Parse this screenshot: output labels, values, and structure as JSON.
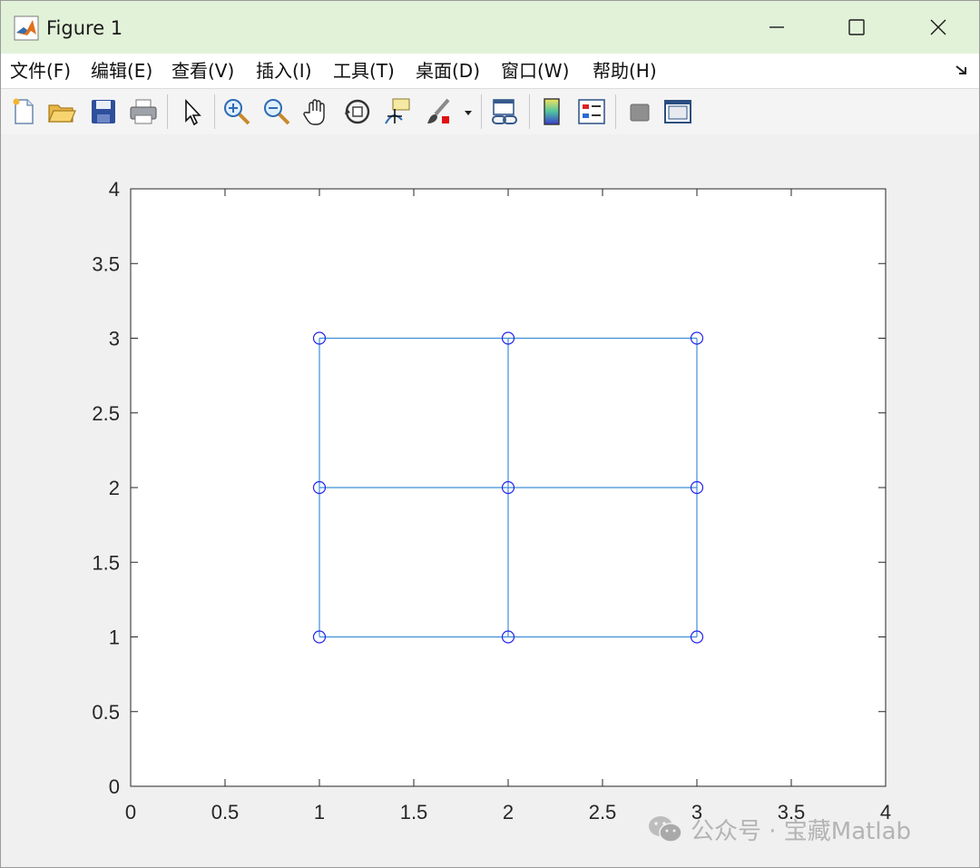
{
  "window": {
    "title": "Figure 1"
  },
  "menu": [
    {
      "label": "文件(F)",
      "name": "menu-file"
    },
    {
      "label": "编辑(E)",
      "name": "menu-edit"
    },
    {
      "label": "查看(V)",
      "name": "menu-view"
    },
    {
      "label": "插入(I)",
      "name": "menu-insert"
    },
    {
      "label": "工具(T)",
      "name": "menu-tools"
    },
    {
      "label": "桌面(D)",
      "name": "menu-desktop"
    },
    {
      "label": "窗口(W)",
      "name": "menu-window"
    },
    {
      "label": "帮助(H)",
      "name": "menu-help"
    }
  ],
  "toolbar": [
    {
      "icon": "new-figure-icon"
    },
    {
      "icon": "open-file-icon"
    },
    {
      "icon": "save-icon"
    },
    {
      "icon": "print-icon"
    },
    {
      "icon": "select-pointer-icon"
    },
    {
      "icon": "zoom-in-icon"
    },
    {
      "icon": "zoom-out-icon"
    },
    {
      "icon": "pan-hand-icon"
    },
    {
      "icon": "rotate-3d-icon"
    },
    {
      "icon": "data-cursor-icon"
    },
    {
      "icon": "brush-icon"
    },
    {
      "icon": "link-plot-icon"
    },
    {
      "icon": "colorbar-icon"
    },
    {
      "icon": "legend-icon"
    },
    {
      "icon": "hide-plot-tools-icon"
    },
    {
      "icon": "show-plot-tools-icon"
    }
  ],
  "colors": {
    "line": "#3f8fd6",
    "marker": "#2323ee",
    "axes_bg": "#ffffff",
    "axis_line": "#262626",
    "title_bar_bg": "#e2f2d9"
  },
  "chart_data": {
    "type": "line",
    "xlim": [
      0,
      4
    ],
    "ylim": [
      0,
      4
    ],
    "xticks": [
      "0",
      "0.5",
      "1",
      "1.5",
      "2",
      "2.5",
      "3",
      "3.5",
      "4"
    ],
    "yticks": [
      "0",
      "0.5",
      "1",
      "1.5",
      "2",
      "2.5",
      "3",
      "3.5",
      "4"
    ],
    "grid": false,
    "series": [
      {
        "x": [
          1,
          1,
          1
        ],
        "y": [
          1,
          2,
          3
        ]
      },
      {
        "x": [
          2,
          2,
          2
        ],
        "y": [
          1,
          2,
          3
        ]
      },
      {
        "x": [
          3,
          3,
          3
        ],
        "y": [
          1,
          2,
          3
        ]
      },
      {
        "x": [
          1,
          2,
          3
        ],
        "y": [
          1,
          1,
          1
        ]
      },
      {
        "x": [
          1,
          2,
          3
        ],
        "y": [
          2,
          2,
          2
        ]
      },
      {
        "x": [
          1,
          2,
          3
        ],
        "y": [
          3,
          3,
          3
        ]
      }
    ],
    "markers": {
      "shape": "circle",
      "points": [
        [
          1,
          1
        ],
        [
          1,
          2
        ],
        [
          1,
          3
        ],
        [
          2,
          1
        ],
        [
          2,
          2
        ],
        [
          2,
          3
        ],
        [
          3,
          1
        ],
        [
          3,
          2
        ],
        [
          3,
          3
        ]
      ]
    }
  },
  "watermark": {
    "text": "公众号 · 宝藏Matlab",
    "icon": "wechat-icon"
  }
}
